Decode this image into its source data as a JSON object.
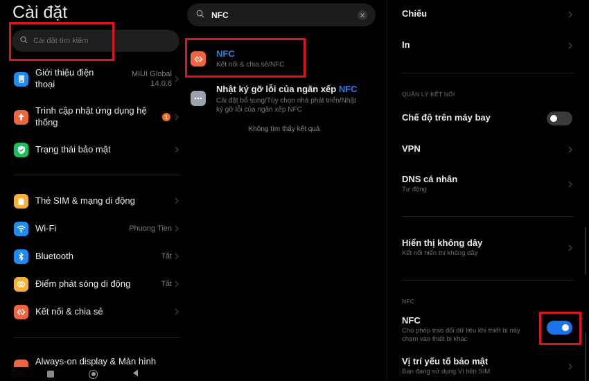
{
  "panel_left": {
    "title": "Cài đặt",
    "search_placeholder": "Cài đặt tìm kiếm",
    "items": [
      {
        "label": "Giới thiệu điện thoại",
        "label_line1": "Giới thiệu điện",
        "label_line2": "thoại",
        "value_line1": "MIUI Global",
        "value_line2": "14.0.6",
        "icon": "phone-icon",
        "color": "#1f8cf0"
      },
      {
        "label": "Trình cập nhật ứng dụng hệ thống",
        "label_line1": "Trình cập nhật ứng dụng hệ",
        "label_line2": "thống",
        "badge": "1",
        "icon": "arrow-up-icon",
        "color": "#f0653d"
      },
      {
        "label": "Trạng thái bảo mật",
        "icon": "shield-check-icon",
        "color": "#1dbf5c"
      },
      {
        "label": "Thẻ SIM & mạng di động",
        "icon": "sim-card-icon",
        "color": "#f4b23c"
      },
      {
        "label": "Wi-Fi",
        "value": "Phuong Tien",
        "icon": "wifi-icon",
        "color": "#1f8cf0"
      },
      {
        "label": "Bluetooth",
        "value": "Tắt",
        "icon": "bluetooth-icon",
        "color": "#1f8cf0"
      },
      {
        "label": "Điểm phát sóng di động",
        "value": "Tắt",
        "icon": "hotspot-icon",
        "color": "#f4b23c"
      },
      {
        "label": "Kết nối & chia sẻ",
        "icon": "connection-share-icon",
        "color": "#f0653d"
      },
      {
        "label": "Always-on display & Màn hình",
        "icon": "display-icon",
        "color": "#f0653d"
      }
    ],
    "nav": [
      "recents-button",
      "home-button",
      "back-button"
    ]
  },
  "panel_middle": {
    "search_query": "NFC",
    "results": [
      {
        "title": "NFC",
        "subtitle": "Kết nối & chia sẻ/NFC",
        "icon": "connection-share-icon",
        "color": "#f0653d"
      },
      {
        "title_prefix": "Nhật ký gỡ lỗi của ngăn xếp ",
        "title_highlight": "NFC",
        "subtitle_line1": "Cài đặt bổ sung/Tùy chọn nhà phát triển/Nhật",
        "subtitle_line2": "ký gỡ lỗi của ngăn xếp NFC",
        "icon": "more-dots-icon",
        "color": "#9aa3ad"
      }
    ],
    "no_result_text": "Không tìm thấy kết quả",
    "highlight_color": "#2f7ee8"
  },
  "panel_right": {
    "items_top": [
      {
        "label": "Chiếu"
      },
      {
        "label": "In"
      }
    ],
    "section_connection": "QUẢN LÝ KẾT NỐI",
    "airplane_mode": {
      "label": "Chế độ trên máy bay",
      "enabled": false
    },
    "vpn": {
      "label": "VPN"
    },
    "dns": {
      "label": "DNS cá nhân",
      "sub": "Tự động"
    },
    "wireless_display": {
      "label": "Hiển thị không dây",
      "sub": "Kết nối hiển thị không dây"
    },
    "section_nfc": "NFC",
    "nfc": {
      "label": "NFC",
      "sub_line1": "Cho phép trao đổi dữ liệu khi thiết bị này",
      "sub_line2": "chạm vào thiết bị khác",
      "enabled": true
    },
    "secure_element": {
      "label": "Vị trí yếu tố bảo mật",
      "sub": "Bạn đang sử dụng Ví tiền SIM"
    },
    "toggle_on_color": "#1a73e8",
    "toggle_off_color": "#3a3a3a"
  }
}
